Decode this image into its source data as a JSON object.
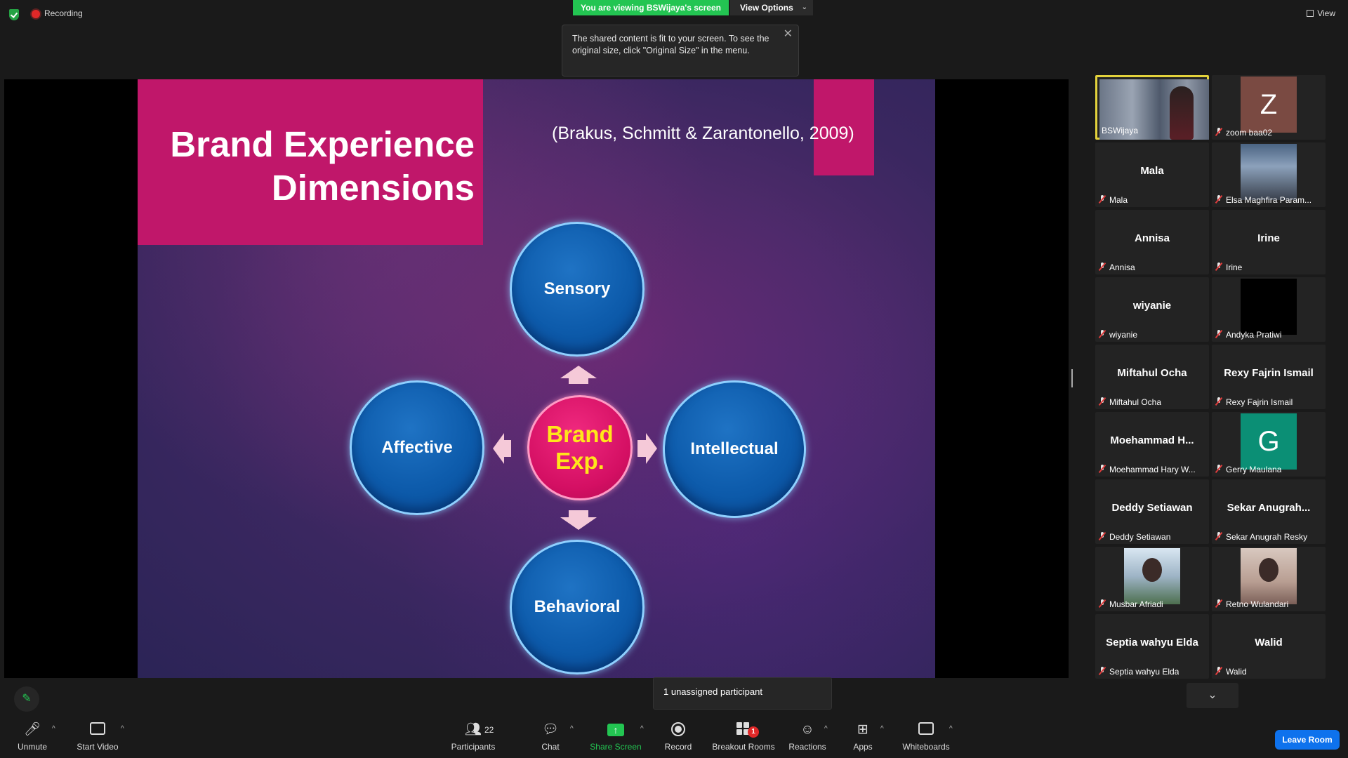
{
  "top": {
    "recording_label": "Recording",
    "viewing_banner": "You are viewing BSWijaya's screen",
    "view_options": "View Options",
    "tooltip_text": "The shared content is fit to your screen. To see the original size, click \"Original Size\" in the menu.",
    "view_label": "View"
  },
  "slide": {
    "title_line1": "Brand Experience",
    "title_line2": "Dimensions",
    "citation": "(Brakus, Schmitt & Zarantonello, 2009)",
    "center_line1": "Brand",
    "center_line2": "Exp.",
    "top_circle": "Sensory",
    "left_circle": "Affective",
    "right_circle": "Intellectual",
    "bottom_circle": "Behavioral"
  },
  "gallery": {
    "tiles": [
      {
        "label": "BSWijaya",
        "big": ""
      },
      {
        "label": "zoom baa02",
        "big": "",
        "initial": "Z",
        "initial_color": "#7a4a42"
      },
      {
        "label": "Mala",
        "big": "Mala"
      },
      {
        "label": "Elsa Maghfira Param...",
        "big": ""
      },
      {
        "label": "Annisa",
        "big": "Annisa"
      },
      {
        "label": "Irine",
        "big": "Irine"
      },
      {
        "label": "wiyanie",
        "big": "wiyanie"
      },
      {
        "label": "Andyka Pratiwi",
        "big": ""
      },
      {
        "label": "Miftahul Ocha",
        "big": "Miftahul Ocha"
      },
      {
        "label": "Rexy Fajrin Ismail",
        "big": "Rexy Fajrin Ismail"
      },
      {
        "label": "Moehammad Hary W...",
        "big": "Moehammad  H..."
      },
      {
        "label": "Gerry Maulana",
        "big": "",
        "initial": "G",
        "initial_color": "#0b8f75"
      },
      {
        "label": "Deddy Setiawan",
        "big": "Deddy Setiawan"
      },
      {
        "label": "Sekar Anugrah Resky",
        "big": "Sekar  Anugrah..."
      },
      {
        "label": "Musbar Afriadi",
        "big": ""
      },
      {
        "label": "Retno Wulandari",
        "big": ""
      },
      {
        "label": "Septia wahyu Elda",
        "big": "Septia wahyu Elda"
      },
      {
        "label": "Walid",
        "big": "Walid"
      }
    ]
  },
  "toolbar": {
    "unmute": "Unmute",
    "start_video": "Start Video",
    "participants": "Participants",
    "participants_count": "22",
    "chat": "Chat",
    "share_screen": "Share Screen",
    "record": "Record",
    "breakout_rooms": "Breakout Rooms",
    "breakout_badge": "1",
    "reactions": "Reactions",
    "apps": "Apps",
    "whiteboards": "Whiteboards",
    "leave_room": "Leave Room",
    "unassigned_popup": "1 unassigned participant"
  },
  "colors": {
    "accent_green": "#23c552",
    "slide_pink": "#c0176a",
    "circle_blue": "#0d5bab",
    "leave_blue": "#0e72ed"
  }
}
